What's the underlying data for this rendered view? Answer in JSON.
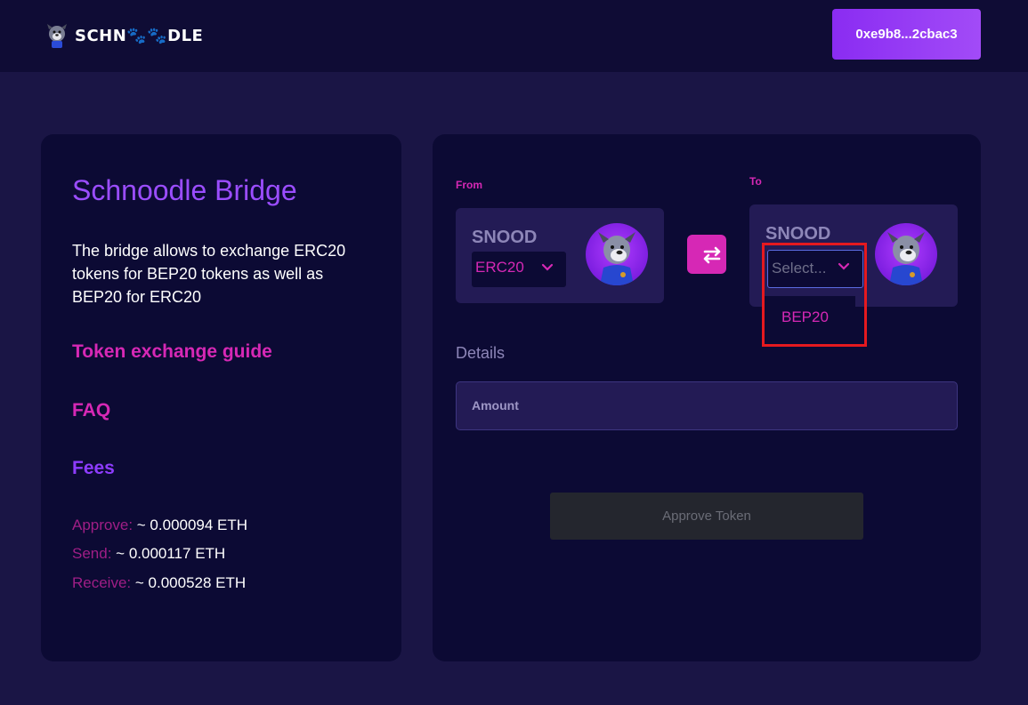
{
  "header": {
    "logo_text_a": "SCHN",
    "logo_text_paws": "🐾🐾",
    "logo_text_b": "DLE",
    "wallet_address": "0xe9b8...2cbac3"
  },
  "sidebar": {
    "title": "Schnoodle Bridge",
    "description": "The bridge allows to exchange ERC20 tokens for BEP20 tokens as well as BEP20 for ERC20",
    "guide_link": "Token exchange guide",
    "faq_link": "FAQ",
    "fees_link": "Fees",
    "fees": [
      {
        "label": "Approve:",
        "value": "~ 0.000094 ETH"
      },
      {
        "label": "Send:",
        "value": "~ 0.000117 ETH"
      },
      {
        "label": "Receive:",
        "value": "~ 0.000528 ETH"
      }
    ]
  },
  "bridge": {
    "from_label": "From",
    "to_label": "To",
    "from_token": "SNOOD",
    "from_network": "ERC20",
    "to_token": "SNOOD",
    "to_placeholder": "Select...",
    "dropdown_options": [
      "BEP20"
    ],
    "details_label": "Details",
    "amount_label": "Amount",
    "approve_label": "Approve Token"
  },
  "colors": {
    "accent_pink": "#d628b5",
    "accent_purple": "#9b4dff",
    "background": "#1a1545",
    "card": "#0c0a34"
  }
}
